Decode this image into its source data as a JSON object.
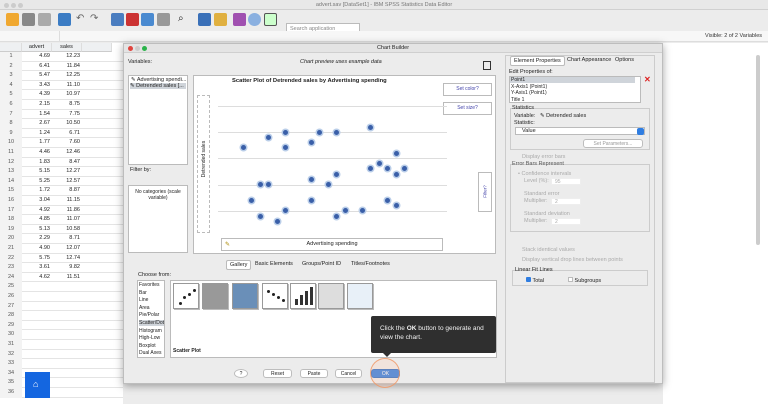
{
  "window": {
    "title": "advert.sav [DataSet1] - IBM SPSS Statistics Data Editor"
  },
  "toolbar": {
    "search_placeholder": "Search application"
  },
  "status": {
    "visible_vars": "Visible: 2 of 2 Variables"
  },
  "grid": {
    "columns": [
      "advert",
      "sales",
      ""
    ],
    "rows": [
      [
        "1",
        "4.69",
        "12.23"
      ],
      [
        "2",
        "6.41",
        "11.84"
      ],
      [
        "3",
        "5.47",
        "12.25"
      ],
      [
        "4",
        "3.43",
        "11.10"
      ],
      [
        "5",
        "4.39",
        "10.97"
      ],
      [
        "6",
        "2.15",
        "8.75"
      ],
      [
        "7",
        "1.54",
        "7.75"
      ],
      [
        "8",
        "2.67",
        "10.50"
      ],
      [
        "9",
        "1.24",
        "6.71"
      ],
      [
        "10",
        "1.77",
        "7.60"
      ],
      [
        "11",
        "4.46",
        "12.46"
      ],
      [
        "12",
        "1.83",
        "8.47"
      ],
      [
        "13",
        "5.15",
        "12.27"
      ],
      [
        "14",
        "5.25",
        "12.57"
      ],
      [
        "15",
        "1.72",
        "8.87"
      ],
      [
        "16",
        "3.04",
        "11.15"
      ],
      [
        "17",
        "4.92",
        "11.86"
      ],
      [
        "18",
        "4.85",
        "11.07"
      ],
      [
        "19",
        "5.13",
        "10.58"
      ],
      [
        "20",
        "2.29",
        "8.71"
      ],
      [
        "21",
        "4.90",
        "12.07"
      ],
      [
        "22",
        "5.75",
        "12.74"
      ],
      [
        "23",
        "3.61",
        "9.82"
      ],
      [
        "24",
        "4.62",
        "11.51"
      ],
      [
        "25",
        "",
        ""
      ],
      [
        "26",
        "",
        ""
      ],
      [
        "27",
        "",
        ""
      ],
      [
        "28",
        "",
        ""
      ],
      [
        "29",
        "",
        ""
      ],
      [
        "30",
        "",
        ""
      ],
      [
        "31",
        "",
        ""
      ],
      [
        "32",
        "",
        ""
      ],
      [
        "33",
        "",
        ""
      ],
      [
        "34",
        "",
        ""
      ],
      [
        "35",
        "",
        ""
      ],
      [
        "36",
        "",
        ""
      ]
    ]
  },
  "dialog": {
    "title": "Chart Builder",
    "variables_label": "Variables:",
    "preview_note": "Chart preview uses example data",
    "variables": [
      "Advertising spendi...",
      "Detrended sales [..."
    ],
    "filter_label": "Filter by:",
    "categories_note": "No categories (scale variable)",
    "preview": {
      "title": "Scatter Plot of Detrended sales by Advertising spending",
      "y_zone": "Detrended sales",
      "x_zone": "Advertising spending",
      "set_color": "Set color?",
      "set_size": "Set size?",
      "filter": "Filter?"
    },
    "tabs": [
      "Gallery",
      "Basic Elements",
      "Groups/Point ID",
      "Titles/Footnotes"
    ],
    "choose_from_label": "Choose from:",
    "chart_types": [
      "Favorites",
      "Bar",
      "Line",
      "Area",
      "Pie/Polar",
      "Scatter/Dot",
      "Histogram",
      "High-Low",
      "Boxplot",
      "Dual Axes"
    ],
    "selected_type": "Scatter/Dot",
    "gallery_caption": "Scatter Plot",
    "gallery_icons": [
      "simple-scatter-icon",
      "3d-scatter-icon",
      "scatter-matrix-icon",
      "grouped-scatter-icon",
      "simple-dot-icon",
      "summary-point-icon",
      "drop-line-icon"
    ],
    "buttons": {
      "help": "?",
      "reset": "Reset",
      "paste": "Paste",
      "cancel": "Cancel",
      "ok": "OK"
    },
    "tooltip": {
      "pre": "Click the ",
      "bold": "OK",
      "post": " button to generate and view the chart."
    }
  },
  "props": {
    "tabs": [
      "Element Properties",
      "Chart Appearance",
      "Options"
    ],
    "edit_label": "Edit Properties of:",
    "elements": [
      "Point1",
      "X-Axis1 (Point1)",
      "Y-Axis1 (Point1)",
      "Title 1"
    ],
    "statistics_label": "Statistics",
    "variable_label": "Variable:",
    "variable_value": "Detrended sales",
    "statistic_label": "Statistic:",
    "statistic_value": "Value",
    "set_params": "Set Parameters...",
    "display_error_bars": "Display error bars",
    "error_bars_label": "Error Bars Represent",
    "ci": "Confidence intervals",
    "level_label": "Level (%):",
    "level_value": "95",
    "std_err": "Standard error",
    "mult_label": "Multiplier:",
    "mult1": "2",
    "std_dev": "Standard deviation",
    "mult2": "2",
    "stack": "Stack identical values",
    "drop_lines": "Display vertical drop lines between points",
    "fit_label": "Linear Fit Lines",
    "total": "Total",
    "subgroups": "Subgroups"
  },
  "chart_data": {
    "type": "scatter",
    "title": "Scatter Plot of Detrended sales by Advertising spending",
    "xlabel": "Advertising spending",
    "ylabel": "Detrended sales",
    "xlim": [
      -2,
      25
    ],
    "ylim": [
      0,
      5.5
    ],
    "grid": "horizontal",
    "points": [
      [
        1,
        3.4
      ],
      [
        4,
        3.8
      ],
      [
        6,
        4
      ],
      [
        6,
        3.4
      ],
      [
        9,
        3.6
      ],
      [
        10,
        4
      ],
      [
        12,
        4
      ],
      [
        16,
        4.2
      ],
      [
        19,
        3.2
      ],
      [
        16,
        2.6
      ],
      [
        17,
        2.8
      ],
      [
        18,
        2.6
      ],
      [
        19,
        2.4
      ],
      [
        20,
        2.6
      ],
      [
        3,
        2
      ],
      [
        4,
        2
      ],
      [
        9,
        2.2
      ],
      [
        12,
        2.4
      ],
      [
        11,
        2
      ],
      [
        2,
        1.4
      ],
      [
        9,
        1.4
      ],
      [
        18,
        1.4
      ],
      [
        19,
        1.2
      ],
      [
        3,
        0.8
      ],
      [
        5,
        0.6
      ],
      [
        6,
        1
      ],
      [
        12,
        0.8
      ],
      [
        13,
        1
      ],
      [
        15,
        1
      ]
    ]
  }
}
